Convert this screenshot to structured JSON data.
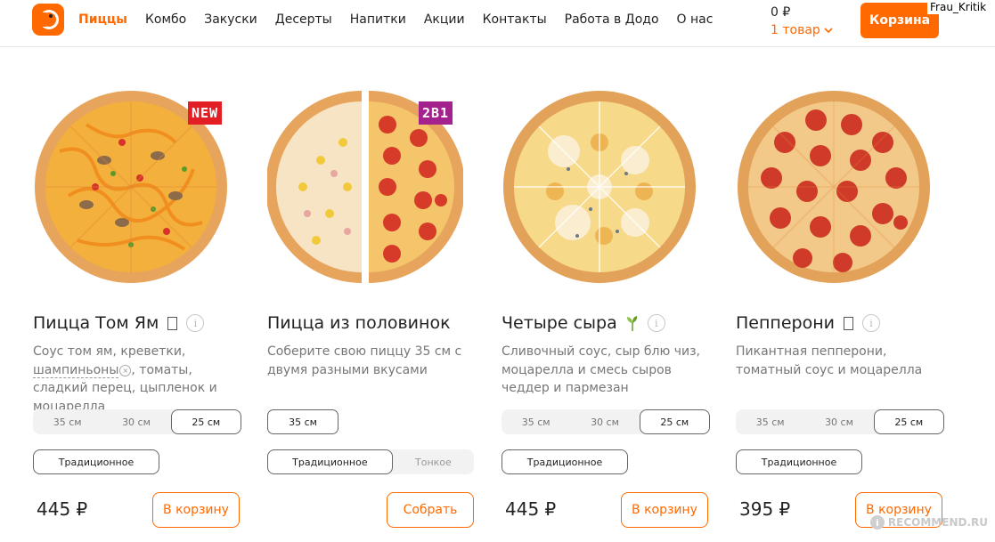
{
  "header": {
    "nav": [
      "Пиццы",
      "Комбо",
      "Закуски",
      "Десерты",
      "Напитки",
      "Акции",
      "Контакты",
      "Работа в Додо",
      "О нас"
    ],
    "cart_total": "0 ₽",
    "cart_count": "1 товар",
    "cart_button": "Корзина",
    "username": "Frau_Kritik"
  },
  "products": [
    {
      "badge": "NEW",
      "title": "Пицца Том Ям",
      "desc_before": "Соус том ям, креветки, ",
      "desc_removable": "шампиньоны",
      "desc_after": ", томаты, сладкий перец, цыпленок и моцарелла",
      "sizes": [
        "35 см",
        "30 см",
        "25 см"
      ],
      "dough": [
        "Традиционное"
      ],
      "price": "445 ₽",
      "cta": "В корзину"
    },
    {
      "badge": "2В1",
      "title": "Пицца из половинок",
      "desc": "Соберите свою пиццу 35 см с двумя разными вкусами",
      "sizes": [
        "35 см"
      ],
      "dough": [
        "Традиционное",
        "Тонкое"
      ],
      "cta": "Собрать"
    },
    {
      "title": "Четыре сыра",
      "desc": "Сливочный соус, сыр блю чиз, моцарелла и смесь сыров чеддер и пармезан",
      "sizes": [
        "35 см",
        "30 см",
        "25 см"
      ],
      "dough": [
        "Традиционное"
      ],
      "price": "445 ₽",
      "cta": "В корзину"
    },
    {
      "title": "Пепперони",
      "desc": "Пикантная пепперони, томатный соус и моцарелла",
      "sizes": [
        "35 см",
        "30 см",
        "25 см"
      ],
      "dough": [
        "Традиционное"
      ],
      "price": "395 ₽",
      "cta": "В корзину"
    }
  ],
  "info_glyph": "i",
  "remove_glyph": "×",
  "watermark": "RECOMMEND.RU",
  "watermark_logo": "i",
  "colors": {
    "accent": "#ff6900",
    "badge_new": "#e31e24",
    "badge_2in1": "#a3228e"
  }
}
